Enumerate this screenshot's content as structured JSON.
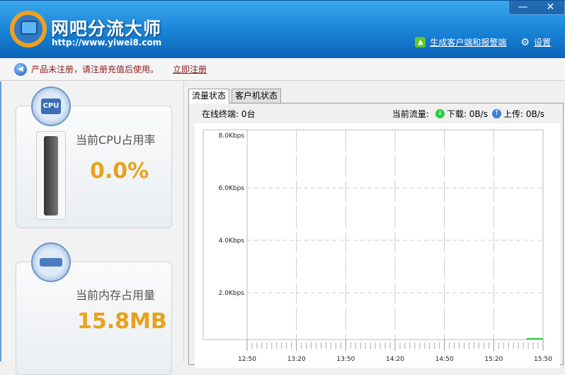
{
  "header": {
    "title": "网吧分流大师",
    "url": "http://www.yiwei8.com",
    "minimize": "—",
    "close": "✕",
    "gen_link": "生成客户端和报警端",
    "settings": "设置"
  },
  "notice": {
    "text": "产品未注册，请注册充值后使用。",
    "link": "立即注册"
  },
  "cpu": {
    "badge": "CPU",
    "label": "当前CPU占用率",
    "value": "0.0%",
    "usage_percent": 0
  },
  "memory": {
    "label": "当前内存占用量",
    "value": "15.8MB"
  },
  "tabs": [
    {
      "label": "流量状态",
      "active": true
    },
    {
      "label": "客户机状态",
      "active": false
    }
  ],
  "status": {
    "online": "在线终端: 0台",
    "current": "当前流量:",
    "download": "下载: 0B/s",
    "upload": "上传: 0B/s"
  },
  "colors": {
    "download": "#2ecc40",
    "upload": "#3a7fd5",
    "value": "#e8a21a"
  },
  "chart_data": {
    "type": "line",
    "ylim": [
      0,
      8
    ],
    "yticks": [
      "8.0Kbps",
      "6.0Kbps",
      "4.0Kbps",
      "2.0Kbps"
    ],
    "ytick_values": [
      8,
      6,
      4,
      2
    ],
    "xticks": [
      "12:50",
      "13:20",
      "13:50",
      "14:20",
      "14:50",
      "15:20",
      "15:50"
    ],
    "grid": true,
    "series": [
      {
        "name": "下载",
        "color": "#2ecc40",
        "x": [
          "15:40",
          "15:50"
        ],
        "values": [
          0,
          0
        ]
      }
    ]
  }
}
